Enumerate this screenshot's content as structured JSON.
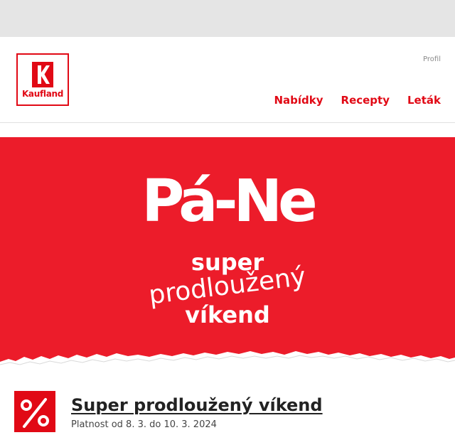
{
  "header": {
    "logo_text": "Kaufland",
    "profile_label": "Profil",
    "nav": [
      {
        "label": "Nabídky"
      },
      {
        "label": "Recepty"
      },
      {
        "label": "Leták"
      }
    ]
  },
  "banner": {
    "title": "Pá-Ne",
    "line1": "super",
    "line2": "prodloužený",
    "line3": "víkend"
  },
  "promo": {
    "icon": "percent-icon",
    "title": "Super prodloužený víkend",
    "validity": "Platnost od 8. 3. do 10. 3. 2024"
  },
  "colors": {
    "brand_red": "#e10915",
    "banner_red": "#ec1c2a",
    "top_bar": "#e5e5e5"
  }
}
